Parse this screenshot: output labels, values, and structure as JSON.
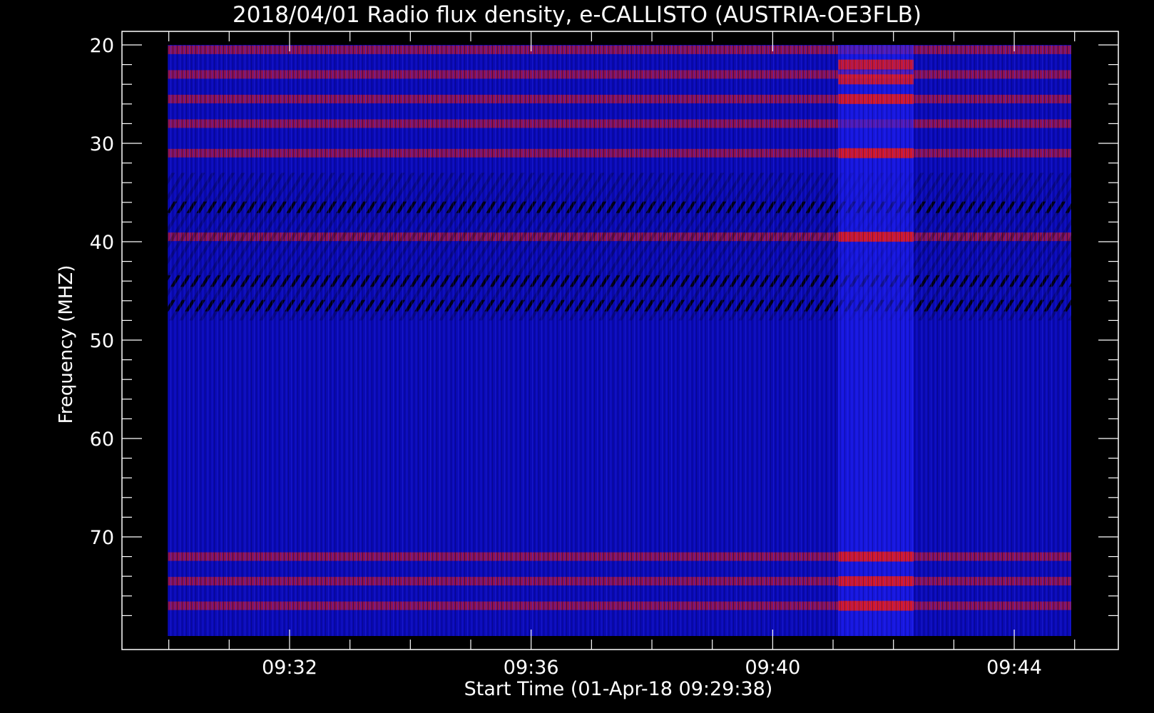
{
  "chart_data": {
    "type": "heatmap",
    "title": "2018/04/01  Radio flux density, e-CALLISTO (AUSTRIA-OE3FLB)",
    "xlabel": "Start Time (01-Apr-18 09:29:38)",
    "ylabel": "Frequency (MHZ)",
    "x_ticks": [
      "09:32",
      "09:36",
      "09:40",
      "09:44"
    ],
    "y_ticks": [
      20,
      30,
      40,
      50,
      60,
      70
    ],
    "ylim": [
      20,
      80
    ],
    "y_inverted": true,
    "xlim_minutes": [
      29.633,
      45.0
    ],
    "colors": {
      "background": "#000000",
      "foreground": "#ffffff",
      "low": "#0a0ab4",
      "mid": "#1a1aff",
      "high": "#ff1a00"
    },
    "features": {
      "red_bands_mhz": [
        20.5,
        23,
        25.5,
        28,
        31,
        39.5,
        72,
        74.5,
        77
      ],
      "dark_bands_mhz": [
        36.5,
        44,
        46.5
      ],
      "burst_window": [
        "09:41:05",
        "09:42:20"
      ]
    }
  }
}
